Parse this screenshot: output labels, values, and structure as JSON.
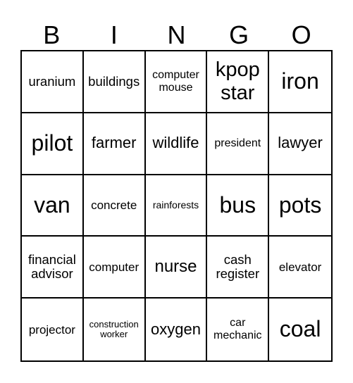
{
  "header": [
    "B",
    "I",
    "N",
    "G",
    "O"
  ],
  "cells": [
    "uranium",
    "buildings",
    "computer mouse",
    "kpop star",
    "iron",
    "pilot",
    "farmer",
    "wildlife",
    "president",
    "lawyer",
    "van",
    "concrete",
    "rainforests",
    "bus",
    "pots",
    "financial advisor",
    "computer",
    "nurse",
    "cash register",
    "elevator",
    "projector",
    "construction worker",
    "oxygen",
    "car mechanic",
    "coal"
  ]
}
